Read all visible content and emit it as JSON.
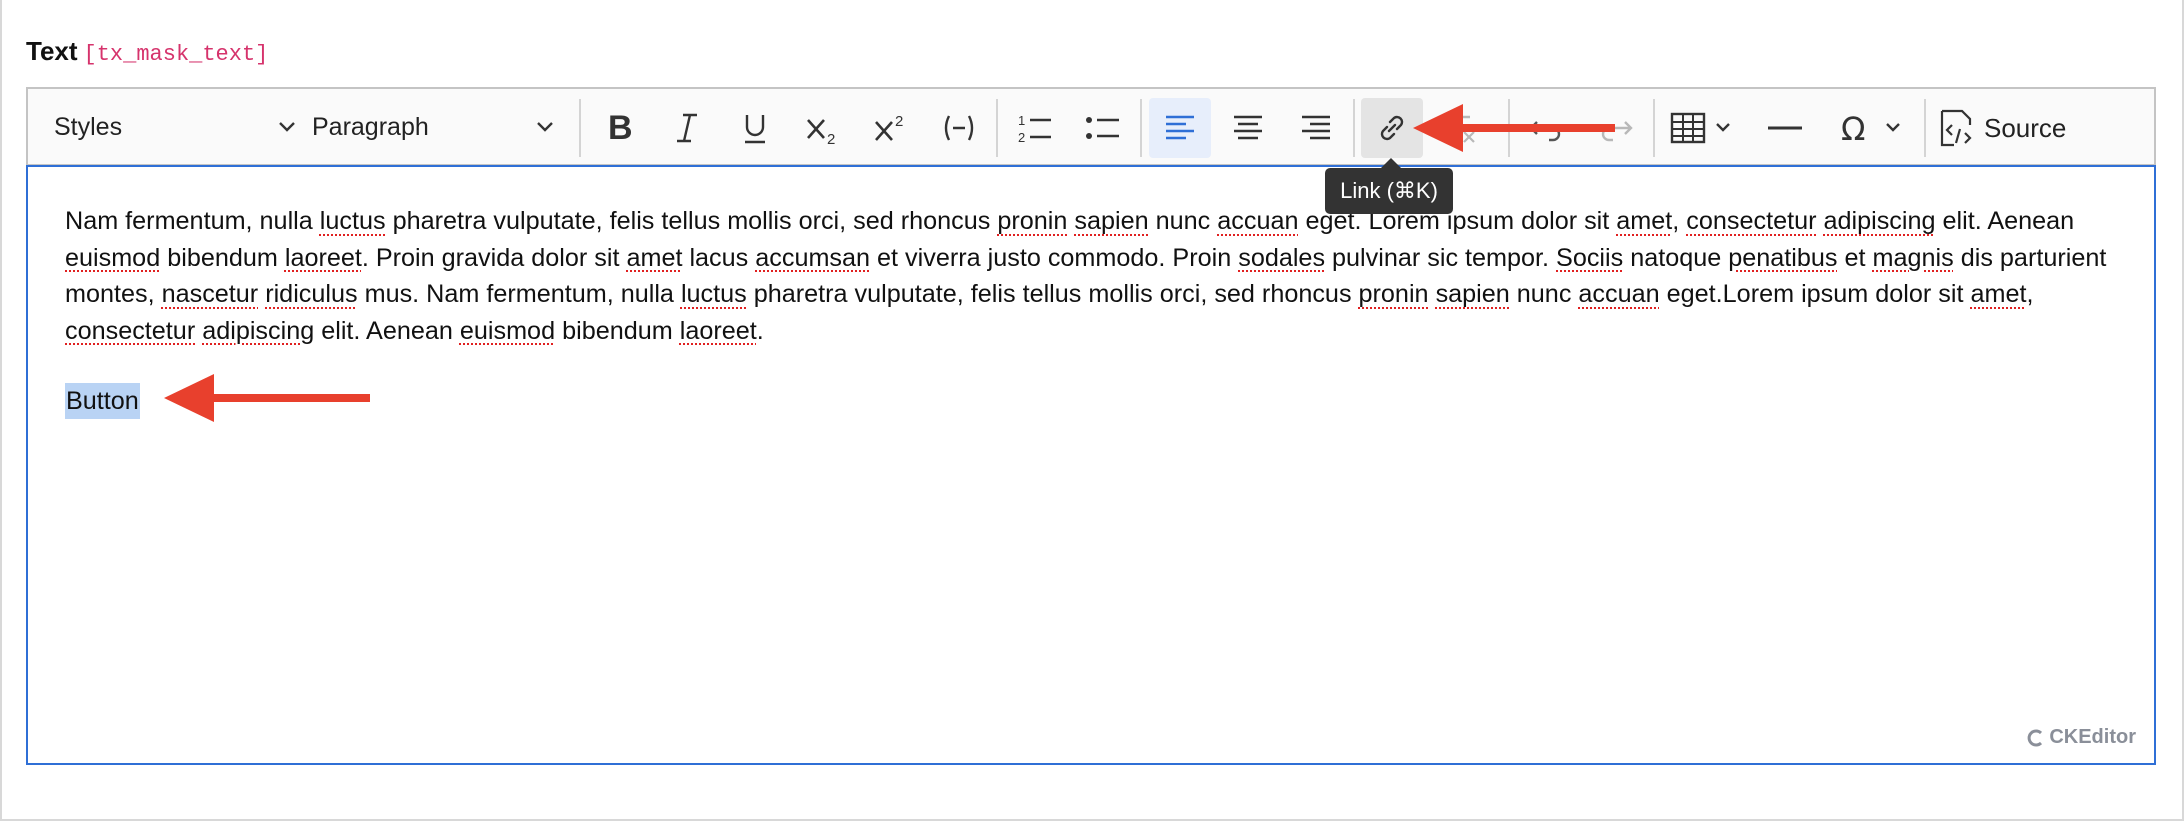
{
  "field": {
    "label": "Text",
    "key": "[tx_mask_text]"
  },
  "toolbar": {
    "styles_label": "Styles",
    "heading_label": "Paragraph",
    "source_label": "Source",
    "icons": [
      "bold-icon",
      "italic-icon",
      "underline-icon",
      "subscript-icon",
      "superscript-icon",
      "soft-hyphen-icon",
      "numbered-list-icon",
      "bulleted-list-icon",
      "align-left-icon",
      "align-center-icon",
      "align-right-icon",
      "link-icon",
      "remove-format-icon",
      "undo-icon",
      "redo-icon",
      "table-icon",
      "horizontal-line-icon",
      "special-characters-icon",
      "source-icon"
    ]
  },
  "tooltip": {
    "text": "Link (⌘K)"
  },
  "editor": {
    "paragraph_segments": [
      {
        "t": "Nam fermentum, nulla ",
        "s": false
      },
      {
        "t": "luctus",
        "s": true
      },
      {
        "t": " pharetra vulputate, felis tellus mollis orci, sed rhoncus ",
        "s": false
      },
      {
        "t": "pronin",
        "s": true
      },
      {
        "t": " ",
        "s": false
      },
      {
        "t": "sapien",
        "s": true
      },
      {
        "t": " nunc ",
        "s": false
      },
      {
        "t": "accuan",
        "s": true
      },
      {
        "t": " eget. Lorem ipsum dolor sit ",
        "s": false
      },
      {
        "t": "amet",
        "s": true
      },
      {
        "t": ", ",
        "s": false
      },
      {
        "t": "consectetur",
        "s": true
      },
      {
        "t": " ",
        "s": false
      },
      {
        "t": "adipiscing",
        "s": true
      },
      {
        "t": " elit. Aenean ",
        "s": false
      },
      {
        "t": "euismod",
        "s": true
      },
      {
        "t": " bibendum ",
        "s": false
      },
      {
        "t": "laoreet",
        "s": true
      },
      {
        "t": ". Proin gravida dolor sit ",
        "s": false
      },
      {
        "t": "amet",
        "s": true
      },
      {
        "t": " lacus ",
        "s": false
      },
      {
        "t": "accumsan",
        "s": true
      },
      {
        "t": " et viverra justo commodo. Proin ",
        "s": false
      },
      {
        "t": "sodales",
        "s": true
      },
      {
        "t": " pulvinar sic tempor. ",
        "s": false
      },
      {
        "t": "Sociis",
        "s": true
      },
      {
        "t": " natoque ",
        "s": false
      },
      {
        "t": "penatibus",
        "s": true
      },
      {
        "t": " et ",
        "s": false
      },
      {
        "t": "magnis",
        "s": true
      },
      {
        "t": " dis parturient montes, ",
        "s": false
      },
      {
        "t": "nascetur",
        "s": true
      },
      {
        "t": " ",
        "s": false
      },
      {
        "t": "ridiculus",
        "s": true
      },
      {
        "t": " mus. Nam fermentum, nulla ",
        "s": false
      },
      {
        "t": "luctus",
        "s": true
      },
      {
        "t": " pharetra vulputate, felis tellus mollis orci, sed rhoncus ",
        "s": false
      },
      {
        "t": "pronin",
        "s": true
      },
      {
        "t": " ",
        "s": false
      },
      {
        "t": "sapien",
        "s": true
      },
      {
        "t": " nunc ",
        "s": false
      },
      {
        "t": "accuan",
        "s": true
      },
      {
        "t": " eget.Lorem ipsum dolor sit ",
        "s": false
      },
      {
        "t": "amet",
        "s": true
      },
      {
        "t": ", ",
        "s": false
      },
      {
        "t": "consectetur",
        "s": true
      },
      {
        "t": " ",
        "s": false
      },
      {
        "t": "adipiscing",
        "s": true
      },
      {
        "t": " elit. Aenean ",
        "s": false
      },
      {
        "t": "euismod",
        "s": true
      },
      {
        "t": " bibendum ",
        "s": false
      },
      {
        "t": "laoreet",
        "s": true
      },
      {
        "t": ".",
        "s": false
      }
    ],
    "selected_text": "Button",
    "brand": "CKEditor"
  },
  "colors": {
    "accent": "#2f6fd6",
    "arrow": "#e8402d",
    "selection": "#b9d3f4",
    "key": "#d6336c"
  }
}
